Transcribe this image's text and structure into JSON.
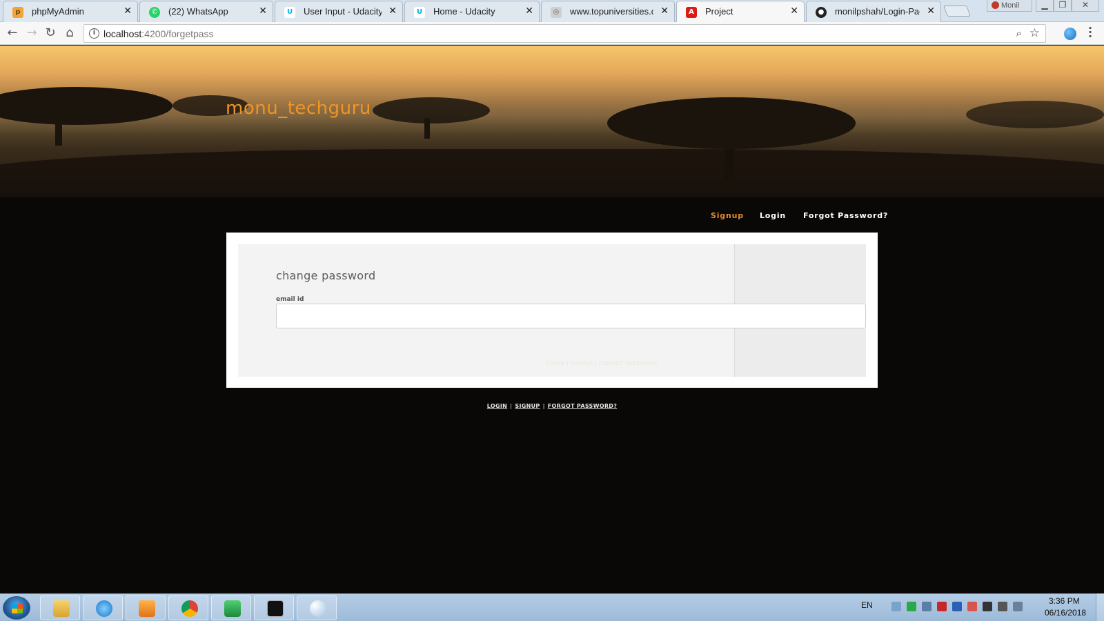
{
  "browser": {
    "tabs": [
      {
        "title": "phpMyAdmin",
        "icon": "phpmyadmin-icon"
      },
      {
        "title": "(22) WhatsApp",
        "icon": "whatsapp-icon",
        "badge": "22"
      },
      {
        "title": "User Input - Udacity",
        "icon": "udacity-icon"
      },
      {
        "title": "Home - Udacity",
        "icon": "udacity-icon"
      },
      {
        "title": "www.topuniversities.com",
        "icon": "globe-icon"
      },
      {
        "title": "Project",
        "icon": "angular-icon",
        "active": true
      },
      {
        "title": "monilpshah/Login-Page-",
        "icon": "github-icon"
      }
    ],
    "profile_name": "Monil",
    "url_host": "localhost",
    "url_path": ":4200/forgetpass"
  },
  "page": {
    "site_title": "monu_techguru",
    "nav": {
      "signup": "Signup",
      "login": "Login",
      "forgot": "Forgot Password?"
    },
    "form": {
      "title": "change password",
      "email_label": "email id",
      "email_value": "",
      "email_placeholder": ""
    },
    "faint_links": "LOGIN | SIGNUP | FORGOT PASSWORD",
    "footer": {
      "login": "LOGIN",
      "signup": "SIGNUP",
      "forgot": "FORGOT PASSWORD?",
      "separator": "|"
    }
  },
  "taskbar": {
    "apps": [
      "file-explorer-icon",
      "internet-explorer-icon",
      "media-player-icon",
      "chrome-icon",
      "vscode-icon",
      "cmd-icon",
      "paint-icon"
    ],
    "language": "EN",
    "time": "3:36 PM",
    "date": "06/16/2018"
  },
  "colors": {
    "accent": "#f19522",
    "nav_active": "#e8892a",
    "page_bg": "#0a0807"
  }
}
